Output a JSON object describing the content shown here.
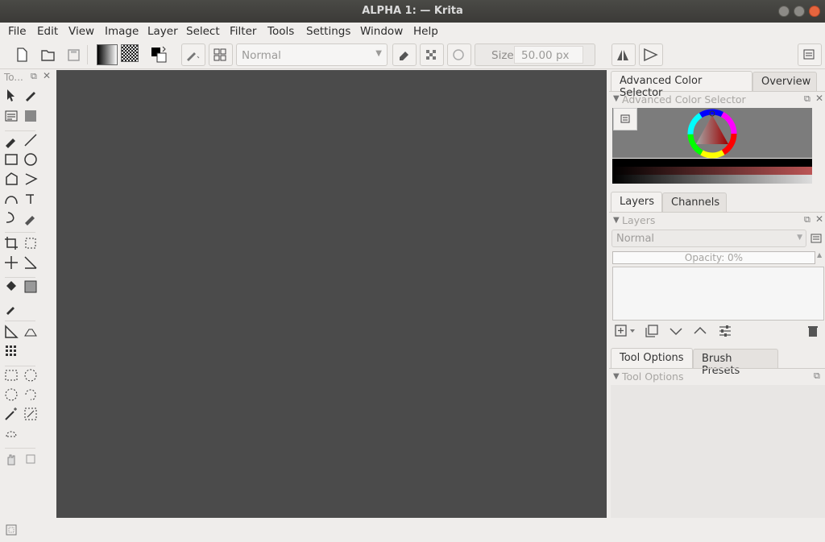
{
  "window": {
    "title": "ALPHA 1:  — Krita"
  },
  "menu": [
    "File",
    "Edit",
    "View",
    "Image",
    "Layer",
    "Select",
    "Filter",
    "Tools",
    "Settings",
    "Window",
    "Help"
  ],
  "toolbar": {
    "blend_mode": "Normal",
    "size_label": "Size:",
    "size_value": "50.00 px"
  },
  "toolbox": {
    "title": "To..."
  },
  "right_panel": {
    "color_tabs": [
      "Advanced Color Selector",
      "Overview"
    ],
    "color_docker_title": "Advanced Color Selector",
    "layer_tabs": [
      "Layers",
      "Channels"
    ],
    "layers_docker_title": "Layers",
    "layer_blend_mode": "Normal",
    "opacity_label": "Opacity:  0%",
    "options_tabs": [
      "Tool Options",
      "Brush Presets"
    ],
    "tool_options_title": "Tool Options"
  },
  "colors": {
    "canvas": "#4b4b4b",
    "accent": "#e6653e"
  }
}
